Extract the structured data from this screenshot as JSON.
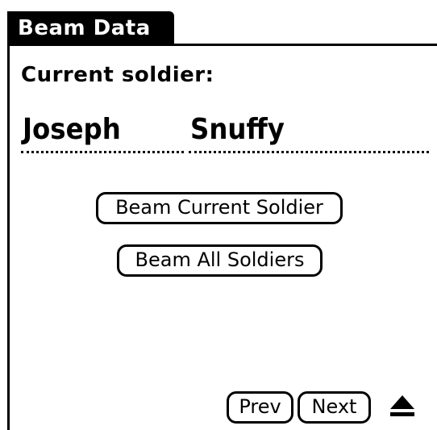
{
  "form": {
    "title": "Beam Data",
    "current_label": "Current soldier:"
  },
  "soldier": {
    "first_name": "Joseph",
    "last_name": "Snuffy"
  },
  "buttons": {
    "beam_current": "Beam Current Soldier",
    "beam_all": "Beam All Soldiers",
    "prev": "Prev",
    "next": "Next"
  },
  "icons": {
    "scroll_up": "up-arrow-icon"
  },
  "colors": {
    "foreground": "#000000",
    "background": "#ffffff"
  }
}
